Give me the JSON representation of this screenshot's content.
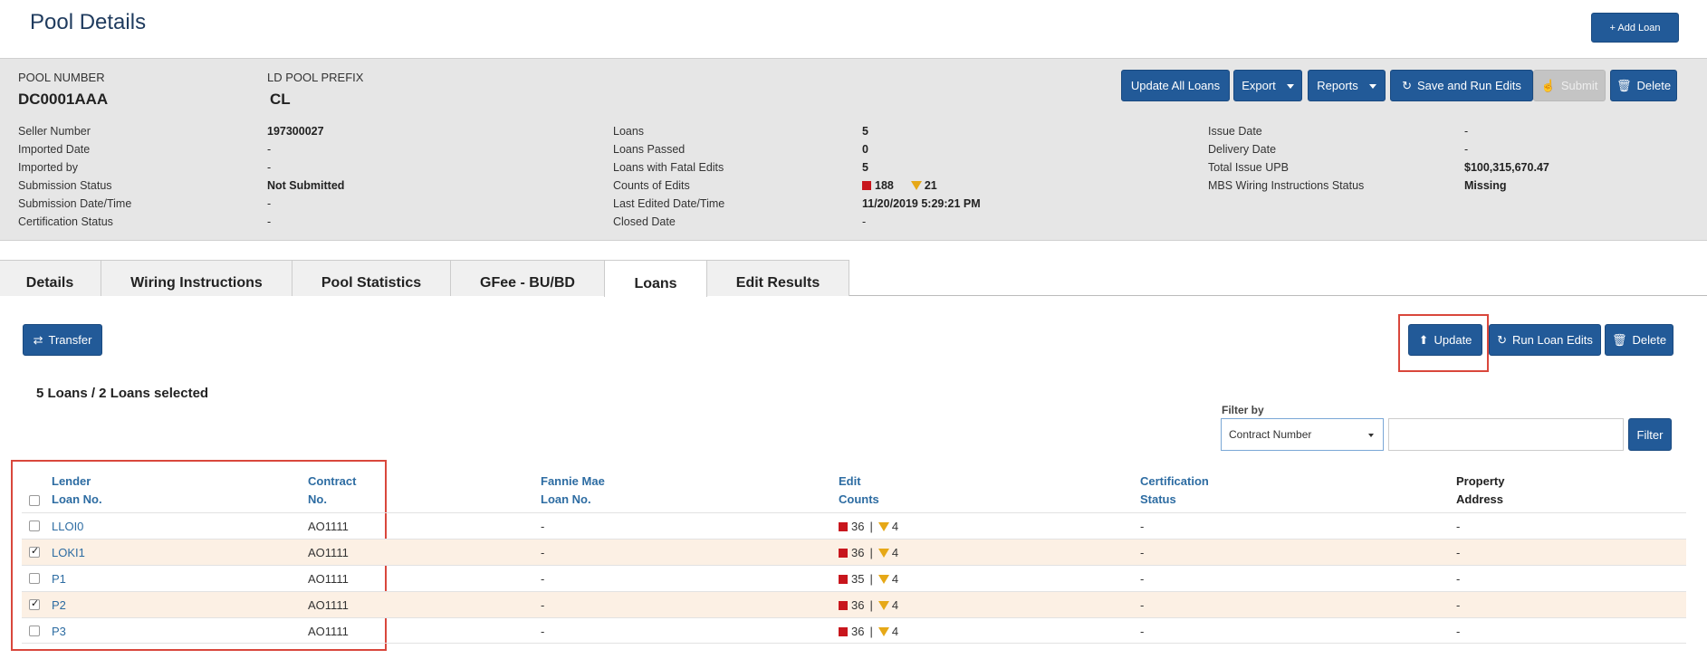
{
  "page": {
    "title": "Pool Details"
  },
  "buttons": {
    "add_loan": "+ Add Loan",
    "update_all_loans": "Update All Loans",
    "export": "Export",
    "reports": "Reports",
    "save_and_run_edits": "Save and Run Edits",
    "submit": "Submit",
    "delete": "Delete",
    "transfer": "Transfer",
    "update": "Update",
    "run_loan_edits": "Run Loan Edits",
    "delete_loans": "Delete",
    "filter": "Filter"
  },
  "pool": {
    "number_label": "POOL NUMBER",
    "number": "DC0001AAA",
    "prefix_label": "LD POOL PREFIX",
    "prefix": "CL"
  },
  "details": {
    "col1": [
      {
        "label": "Seller Number",
        "value": "197300027"
      },
      {
        "label": "Imported Date",
        "value": "-"
      },
      {
        "label": "Imported by",
        "value": "-"
      },
      {
        "label": "Submission Status",
        "value": "Not Submitted"
      },
      {
        "label": "Submission Date/Time",
        "value": "-"
      },
      {
        "label": "Certification Status",
        "value": "-"
      }
    ],
    "col2": [
      {
        "label": "Loans",
        "value": "5"
      },
      {
        "label": "Loans Passed",
        "value": "0"
      },
      {
        "label": "Loans with Fatal Edits",
        "value": "5"
      },
      {
        "label": "Counts of Edits",
        "red": "188",
        "yellow": "21"
      },
      {
        "label": "Last Edited Date/Time",
        "value": "11/20/2019 5:29:21 PM"
      },
      {
        "label": "Closed Date",
        "value": "-"
      }
    ],
    "col3": [
      {
        "label": "Issue Date",
        "value": "-"
      },
      {
        "label": "Delivery Date",
        "value": "-"
      },
      {
        "label": "Total Issue UPB",
        "value": "$100,315,670.47"
      },
      {
        "label": "MBS Wiring Instructions Status",
        "value": "Missing"
      }
    ]
  },
  "tabs": [
    "Details",
    "Wiring Instructions",
    "Pool Statistics",
    "GFee - BU/BD",
    "Loans",
    "Edit Results"
  ],
  "active_tab": "Loans",
  "loans": {
    "selection_summary": "5 Loans / 2 Loans selected",
    "filter_label": "Filter by",
    "filter_selected": "Contract Number",
    "headers": {
      "lender_1": "Lender",
      "lender_2": "Loan No.",
      "contract_1": "Contract",
      "contract_2": "No.",
      "fannie_1": "Fannie Mae",
      "fannie_2": "Loan No.",
      "edit_1": "Edit",
      "edit_2": "Counts",
      "cert_1": "Certification",
      "cert_2": "Status",
      "prop_1": "Property",
      "prop_2": "Address"
    },
    "rows": [
      {
        "lender": "LLOI0",
        "contract": "AO1111",
        "fannie": "-",
        "red": "36",
        "yellow": "4",
        "cert": "-",
        "address": "-",
        "checked": false
      },
      {
        "lender": "LOKI1",
        "contract": "AO1111",
        "fannie": "-",
        "red": "36",
        "yellow": "4",
        "cert": "-",
        "address": "-",
        "checked": true
      },
      {
        "lender": "P1",
        "contract": "AO1111",
        "fannie": "-",
        "red": "35",
        "yellow": "4",
        "cert": "-",
        "address": "-",
        "checked": false
      },
      {
        "lender": "P2",
        "contract": "AO1111",
        "fannie": "-",
        "red": "36",
        "yellow": "4",
        "cert": "-",
        "address": "-",
        "checked": true
      },
      {
        "lender": "P3",
        "contract": "AO1111",
        "fannie": "-",
        "red": "36",
        "yellow": "4",
        "cert": "-",
        "address": "-",
        "checked": false
      }
    ]
  },
  "colors": {
    "primary": "#225a98",
    "fatal": "#c8161d",
    "warning": "#e6a817",
    "highlight_box": "#d9473c",
    "selected_row": "#fcf0e4"
  }
}
